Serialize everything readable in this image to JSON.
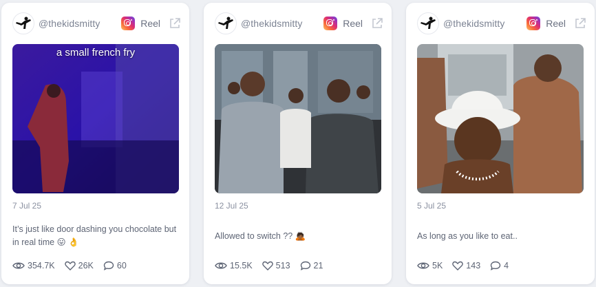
{
  "cards": [
    {
      "handle": "@thekidsmitty",
      "type": "Reel",
      "overlay_text": "a small french fry",
      "date": "7 Jul 25",
      "text": "It’s just like door dashing you chocolate but in real time 😛 👌",
      "views": "354.7K",
      "likes": "26K",
      "comments": "60"
    },
    {
      "handle": "@thekidsmitty",
      "type": "Reel",
      "date": "12 Jul 25",
      "text": "Allowed to switch ?? 🙇🏾",
      "views": "15.5K",
      "likes": "513",
      "comments": "21"
    },
    {
      "handle": "@thekidsmitty",
      "type": "Reel",
      "date": "5 Jul 25",
      "text": "As long as you like to eat..",
      "views": "5K",
      "likes": "143",
      "comments": "4"
    }
  ],
  "colors": {
    "page_bg": "#eef0f4",
    "card_bg": "#ffffff",
    "text": "#5d6474",
    "muted": "#8a90a0"
  }
}
